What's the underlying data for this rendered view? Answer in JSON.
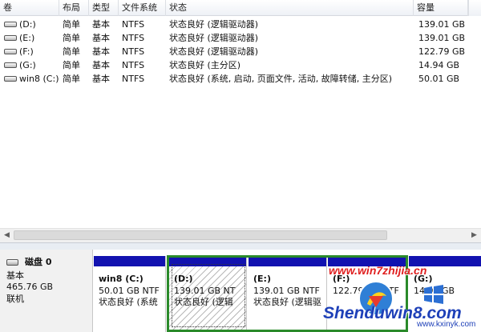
{
  "volume_list": {
    "columns": [
      "卷",
      "布局",
      "类型",
      "文件系统",
      "状态",
      "容量"
    ],
    "rows": [
      {
        "volume": "(D:)",
        "layout": "简单",
        "type": "基本",
        "fs": "NTFS",
        "status": "状态良好 (逻辑驱动器)",
        "capacity": "139.01 GB"
      },
      {
        "volume": "(E:)",
        "layout": "简单",
        "type": "基本",
        "fs": "NTFS",
        "status": "状态良好 (逻辑驱动器)",
        "capacity": "139.01 GB"
      },
      {
        "volume": "(F:)",
        "layout": "简单",
        "type": "基本",
        "fs": "NTFS",
        "status": "状态良好 (逻辑驱动器)",
        "capacity": "122.79 GB"
      },
      {
        "volume": "(G:)",
        "layout": "简单",
        "type": "基本",
        "fs": "NTFS",
        "status": "状态良好 (主分区)",
        "capacity": "14.94 GB"
      },
      {
        "volume": "win8 (C:)",
        "layout": "简单",
        "type": "基本",
        "fs": "NTFS",
        "status": "状态良好 (系统, 启动, 页面文件, 活动, 故障转储, 主分区)",
        "capacity": "50.01 GB"
      }
    ]
  },
  "scrollbar": {
    "left_icon": "arrow-left-icon",
    "right_icon": "arrow-right-icon"
  },
  "disk": {
    "name": "磁盘 0",
    "type": "基本",
    "size": "465.76 GB",
    "status": "联机",
    "icon": "disk-icon"
  },
  "partitions": [
    {
      "name": "win8  (C:)",
      "size": "50.01 GB NTF",
      "status": "状态良好 (系统"
    },
    {
      "name": "(D:)",
      "size": "139.01 GB NT",
      "status": "状态良好 (逻辑"
    },
    {
      "name": "(E:)",
      "size": "139.01 GB NTF",
      "status": "状态良好 (逻辑驱"
    },
    {
      "name": "(F:)",
      "size": "122.79 GB NTF",
      "status": ""
    },
    {
      "name": "(G:)",
      "size": "14.94 GB",
      "status": ""
    }
  ],
  "colors": {
    "partition_bar": "#1212b0",
    "extended_frame": "#2a8a2a",
    "header_bg": "#eef1f6"
  },
  "watermark": {
    "url": "www.win7zhijia.cn",
    "brand": "Shenduwin8.com",
    "site": "www.kxinyk.com"
  }
}
